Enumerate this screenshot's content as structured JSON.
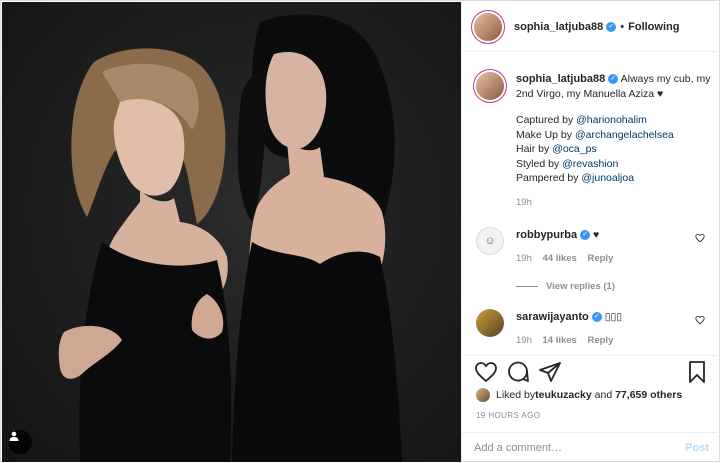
{
  "header": {
    "username": "sophia_latjuba88",
    "separator": "•",
    "follow_label": "Following"
  },
  "caption": {
    "username": "sophia_latjuba88",
    "text": "Always my cub, my 2nd Virgo, my Manuella Aziza ♥",
    "credits": [
      {
        "label": "Captured by ",
        "handle": "@harionohalim"
      },
      {
        "label": "Make Up by ",
        "handle": "@archangelachelsea"
      },
      {
        "label": "Hair by ",
        "handle": "@oca_ps"
      },
      {
        "label": "Styled by ",
        "handle": "@revashion"
      },
      {
        "label": "Pampered by ",
        "handle": "@junoaljoa"
      }
    ],
    "time": "19h"
  },
  "comments": [
    {
      "username": "robbypurba",
      "text": "♥",
      "time": "19h",
      "likes": "44 likes",
      "reply_label": "Reply",
      "view_replies": "View replies (1)"
    },
    {
      "username": "sarawijayanto",
      "text": "▯▯▯",
      "time": "19h",
      "likes": "14 likes",
      "reply_label": "Reply"
    }
  ],
  "likes": {
    "prefix": "Liked by ",
    "user": "teukuzacky",
    "middle": " and ",
    "count": "77,659 others"
  },
  "timestamp": "19 HOURS AGO",
  "add_comment": {
    "placeholder": "Add a comment…",
    "post_label": "Post"
  },
  "icons": {
    "like": "heart-icon",
    "comment": "comment-icon",
    "share": "share-icon",
    "save": "bookmark-icon",
    "tag": "user-tag-icon"
  },
  "colors": {
    "verified": "#3897f0",
    "link": "#00376b",
    "post_disabled": "#b2dffc",
    "photo_bg": "#1f1f1f"
  }
}
